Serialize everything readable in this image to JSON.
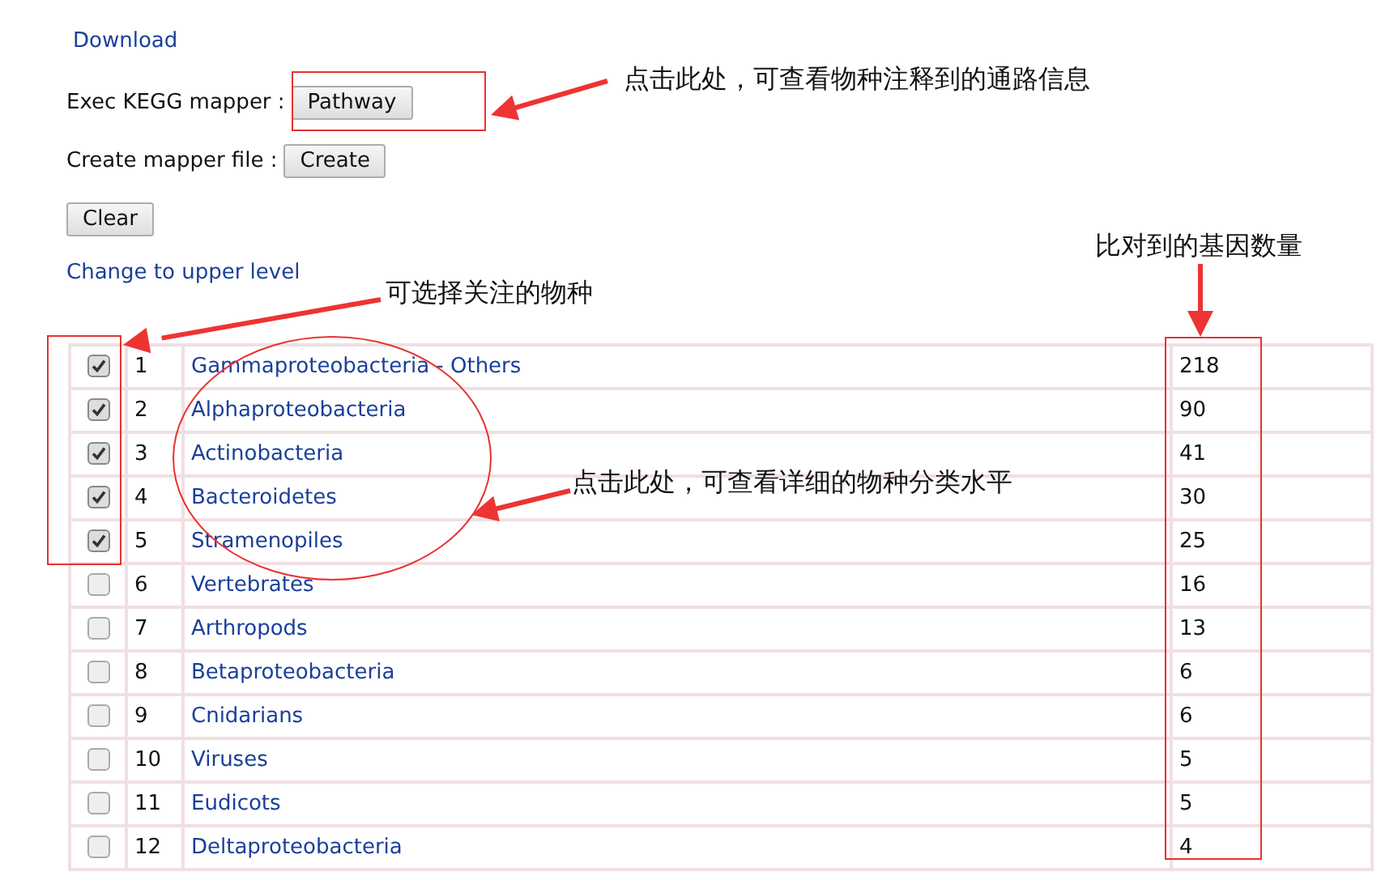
{
  "download_link": "Download",
  "mapper_row": {
    "label": "Exec KEGG mapper :",
    "button": "Pathway"
  },
  "create_row": {
    "label": "Create mapper file :",
    "button": "Create"
  },
  "clear_button": "Clear",
  "upper_level_link": "Change to upper level",
  "table": {
    "rows": [
      {
        "checked": true,
        "index": "1",
        "name": "Gammaproteobacteria - Others",
        "count": "218"
      },
      {
        "checked": true,
        "index": "2",
        "name": "Alphaproteobacteria",
        "count": "90"
      },
      {
        "checked": true,
        "index": "3",
        "name": "Actinobacteria",
        "count": "41"
      },
      {
        "checked": true,
        "index": "4",
        "name": "Bacteroidetes",
        "count": "30"
      },
      {
        "checked": true,
        "index": "5",
        "name": "Stramenopiles",
        "count": "25"
      },
      {
        "checked": false,
        "index": "6",
        "name": "Vertebrates",
        "count": "16"
      },
      {
        "checked": false,
        "index": "7",
        "name": "Arthropods",
        "count": "13"
      },
      {
        "checked": false,
        "index": "8",
        "name": "Betaproteobacteria",
        "count": "6"
      },
      {
        "checked": false,
        "index": "9",
        "name": "Cnidarians",
        "count": "6"
      },
      {
        "checked": false,
        "index": "10",
        "name": "Viruses",
        "count": "5"
      },
      {
        "checked": false,
        "index": "11",
        "name": "Eudicots",
        "count": "5"
      },
      {
        "checked": false,
        "index": "12",
        "name": "Deltaproteobacteria",
        "count": "4"
      }
    ]
  },
  "annotations": [
    {
      "text": "点击此处，可查看物种注释到的通路信息"
    },
    {
      "text": "可选择关注的物种"
    },
    {
      "text": "点击此处，可查看详细的物种分类水平"
    },
    {
      "text": "比对到的基因数量"
    }
  ]
}
